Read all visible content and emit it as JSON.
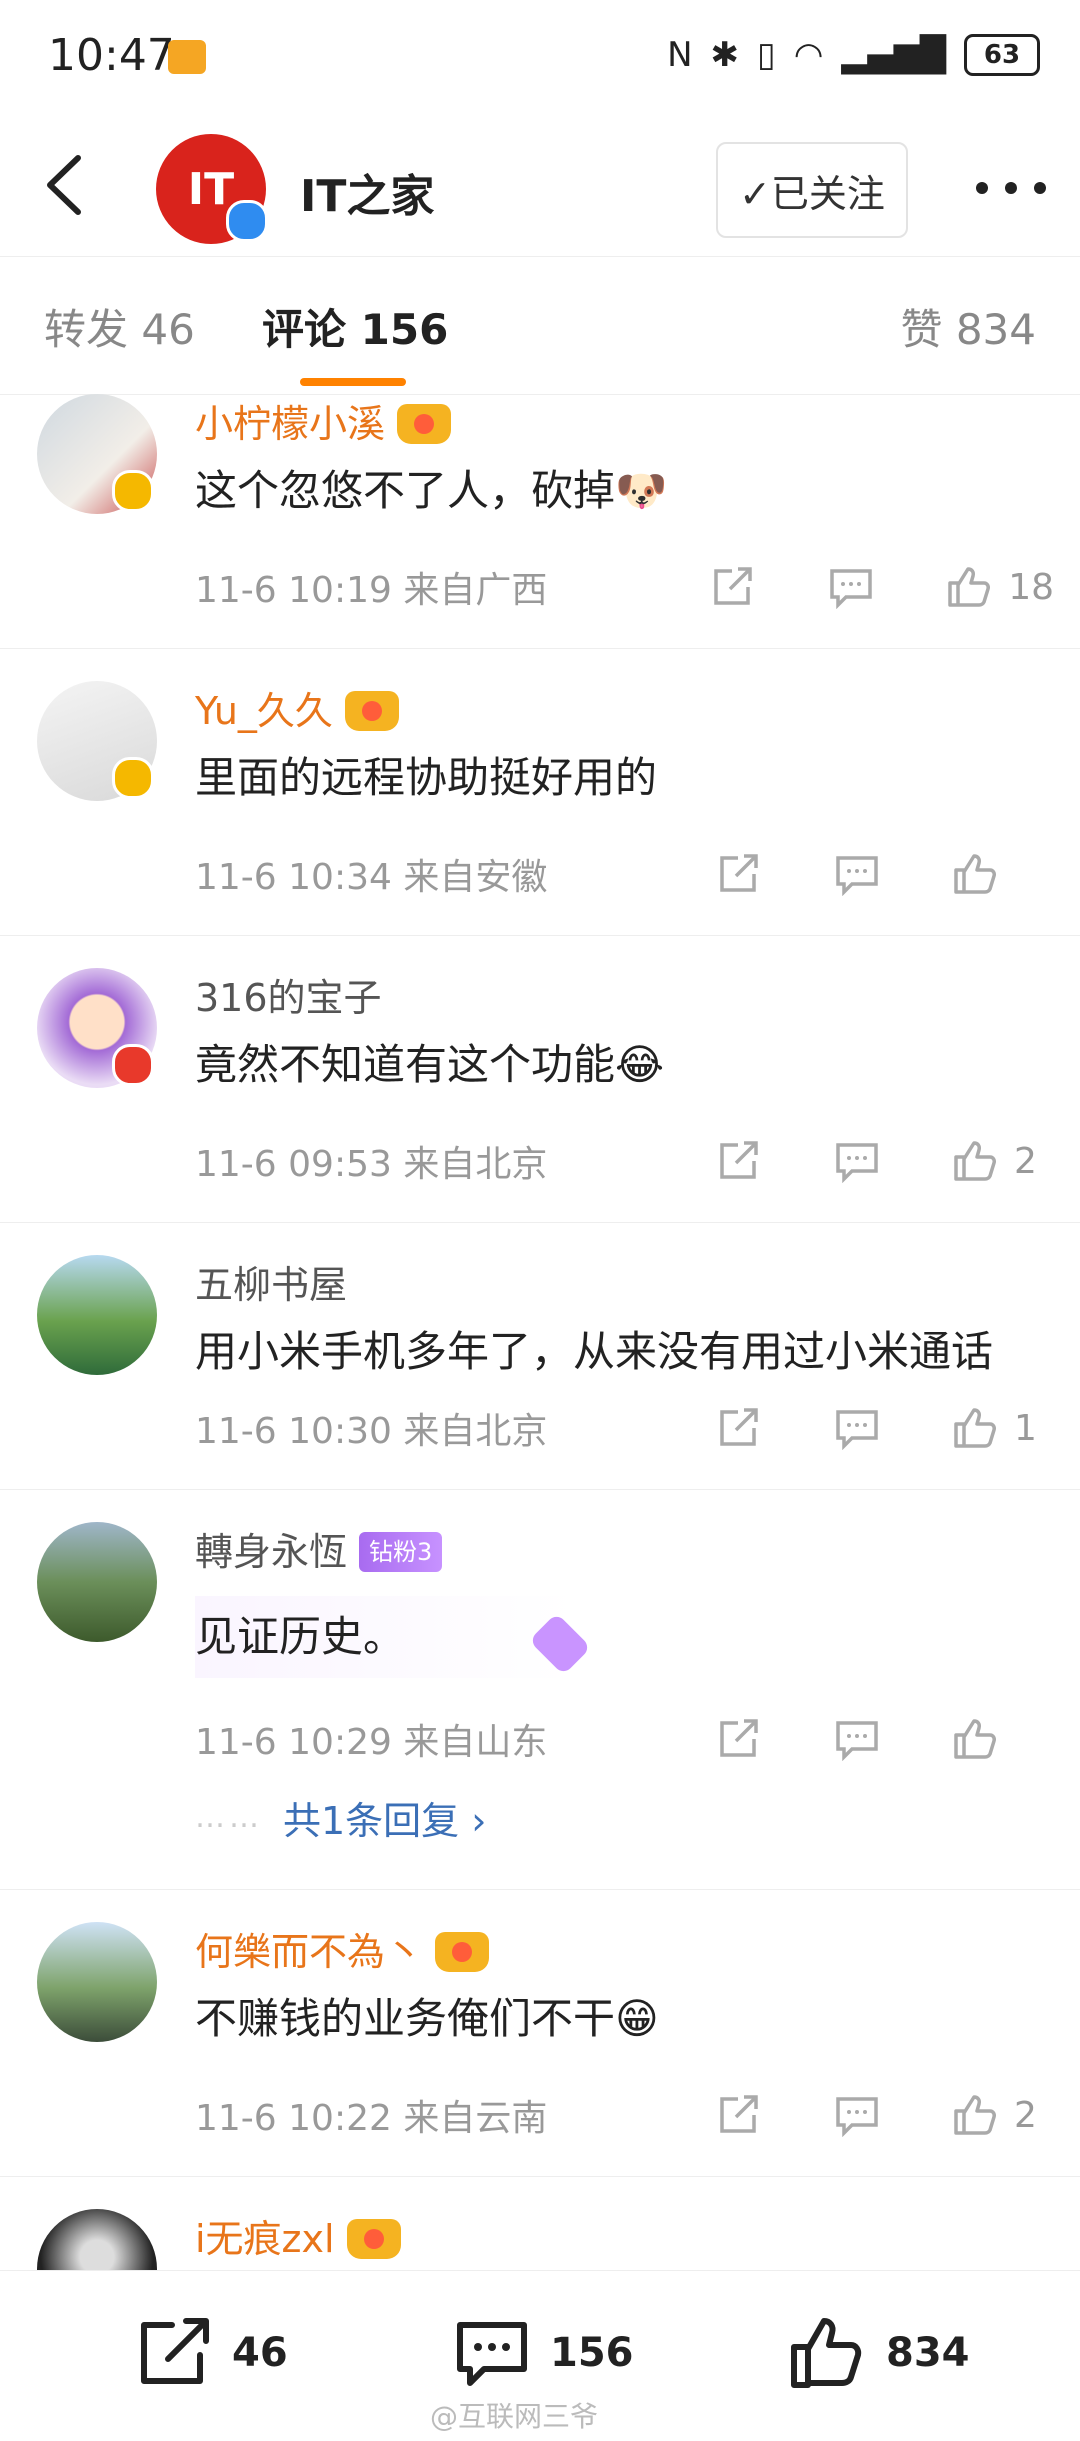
{
  "status_bar": {
    "time": "10:47",
    "battery": "63"
  },
  "header": {
    "account_name": "IT之家",
    "logo_text": "IT",
    "follow_label": "✓已关注"
  },
  "tabs": [
    {
      "label": "转发 46"
    },
    {
      "label": "评论 156"
    },
    {
      "label": "赞 834"
    }
  ],
  "comments": [
    {
      "user": "小柠檬小溪",
      "text": "这个忽悠不了人，砍掉🐶",
      "time": "11-6 10:19 来自广西",
      "likes": "18"
    },
    {
      "user": "Yu_久久",
      "text": "里面的远程协助挺好用的",
      "time": "11-6 10:34 来自安徽",
      "likes": ""
    },
    {
      "user": "316的宝子",
      "text": "竟然不知道有这个功能😂",
      "time": "11-6 09:53 来自北京",
      "likes": "2"
    },
    {
      "user": "五柳书屋",
      "text": "用小米手机多年了，从来没有用过小米通话",
      "time": "11-6 10:30 来自北京",
      "likes": "1"
    },
    {
      "user": "轉身永恆",
      "fan_badge": "钻粉3",
      "text": "见证历史。",
      "time": "11-6 10:29 来自山东",
      "likes": "",
      "replies": "共1条回复 ›",
      "replies_dots": "……"
    },
    {
      "user": "何樂而不為丶",
      "text": "不赚钱的业务俺们不干😁",
      "time": "11-6 10:22 来自云南",
      "likes": "2"
    },
    {
      "user": "i无痕zxl"
    }
  ],
  "bottom_bar": {
    "reposts": "46",
    "comments": "156",
    "likes": "834",
    "watermark": "@互联网三爷"
  },
  "colors": {
    "accent": "#ff8200",
    "vip_name": "#e8751a",
    "link": "#3b6fb6"
  }
}
